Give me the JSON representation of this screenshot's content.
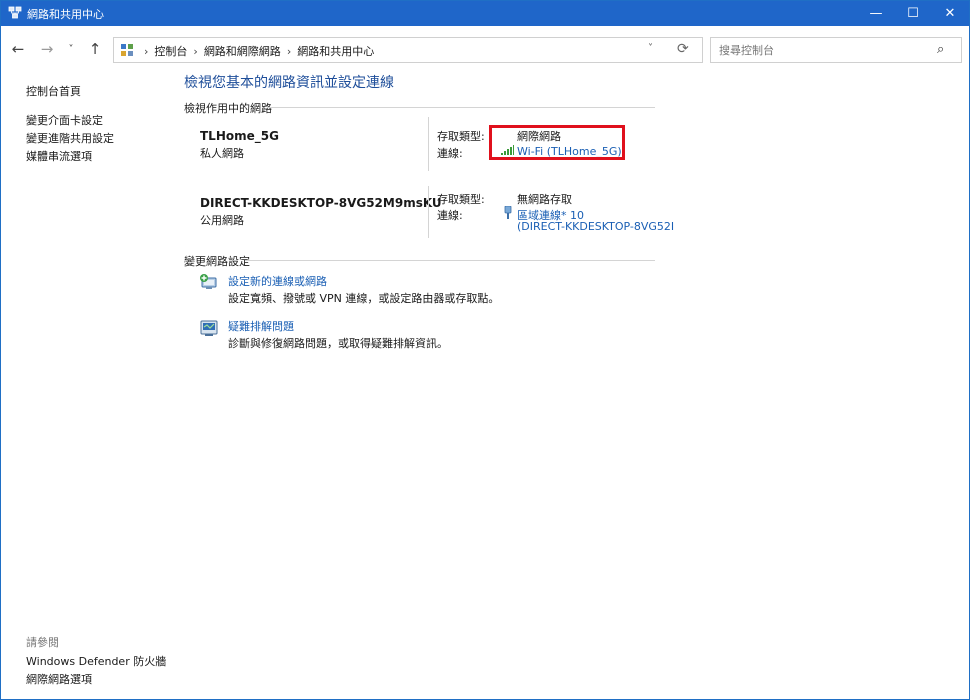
{
  "window": {
    "title": "網路和共用中心"
  },
  "titlebar": {
    "min_glyph": "—",
    "max_glyph": "☐",
    "close_glyph": "✕"
  },
  "nav": {
    "back_glyph": "←",
    "forward_glyph": "→",
    "recent_glyph": "˅",
    "up_glyph": "↑"
  },
  "address": {
    "crumbs": [
      "控制台",
      "網路和網際網路",
      "網路和共用中心"
    ],
    "separator": "›",
    "dropdown_glyph": "˅",
    "refresh_glyph": "⟳"
  },
  "search": {
    "placeholder": "搜尋控制台",
    "value": "",
    "icon_glyph": "⌕"
  },
  "sidebar": {
    "items": [
      {
        "label": "控制台首頁"
      },
      {
        "label": "變更介面卡設定"
      },
      {
        "label": "變更進階共用設定"
      },
      {
        "label": "媒體串流選項"
      }
    ],
    "see_also_title": "請參閱",
    "see_also": [
      {
        "label": "Windows Defender 防火牆"
      },
      {
        "label": "網際網路選項"
      }
    ]
  },
  "main": {
    "title": "檢視您基本的網路資訊並設定連線",
    "active_header": "檢視作用中的網路",
    "networks": [
      {
        "name": "TLHome_5G",
        "category": "私人網路",
        "access_label": "存取類型:",
        "access_value": "網際網路",
        "conn_label": "連線:",
        "conn_value": "Wi-Fi (TLHome_5G)"
      },
      {
        "name": "DIRECT-KKDESKTOP-8VG52M9msKU",
        "category": "公用網路",
        "access_label": "存取類型:",
        "access_value": "無網路存取",
        "conn_label": "連線:",
        "conn_value": "區域連線* 10",
        "conn_value_line2": "(DIRECT-KKDESKTOP-8VG52I"
      }
    ],
    "change_header": "變更網路設定",
    "tasks": [
      {
        "link": "設定新的連線或網路",
        "desc": "設定寬頻、撥號或 VPN 連線，或設定路由器或存取點。"
      },
      {
        "link": "疑難排解問題",
        "desc": "診斷與修復網路問題，或取得疑難排解資訊。"
      }
    ]
  },
  "colors": {
    "titlebar": "#1f66c9",
    "link": "#1a5fb4",
    "title": "#1e4e9a",
    "highlight": "#e0101c"
  }
}
